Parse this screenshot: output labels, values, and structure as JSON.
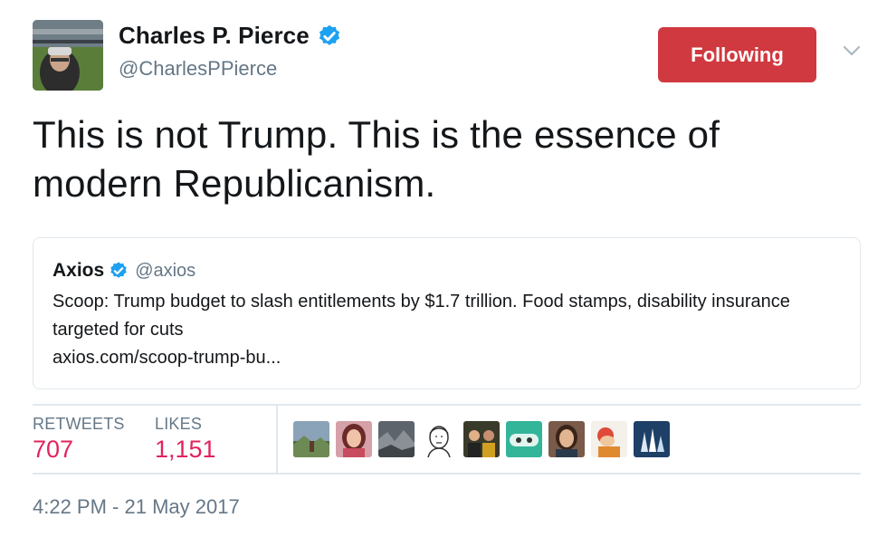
{
  "author": {
    "name": "Charles P. Pierce",
    "handle": "@CharlesPPierce",
    "verified": true
  },
  "follow_button": {
    "label": "Following",
    "color": "#d0393f"
  },
  "tweet": {
    "text": "This is not Trump. This is the essence of modern Republicanism."
  },
  "quoted_tweet": {
    "name": "Axios",
    "handle": "@axios",
    "verified": true,
    "text": "Scoop: Trump budget to slash entitlements by $1.7 trillion. Food stamps, disability insurance targeted for cuts",
    "link": "axios.com/scoop-trump-bu..."
  },
  "stats": {
    "retweets_label": "RETWEETS",
    "retweets_value": "707",
    "likes_label": "LIKES",
    "likes_value": "1,151"
  },
  "liker_avatars": [
    "liker-avatar-landscape",
    "liker-avatar-woman",
    "liker-avatar-rocks",
    "liker-avatar-sketch",
    "liker-avatar-group",
    "liker-avatar-mint",
    "liker-avatar-portrait",
    "liker-avatar-cartoon",
    "liker-avatar-ice"
  ],
  "timestamp": "4:22 PM - 21 May 2017",
  "colors": {
    "accent_like": "#e0245e",
    "verified_blue": "#1da1f2",
    "secondary_text": "#657786",
    "border": "#e1e8ed"
  }
}
